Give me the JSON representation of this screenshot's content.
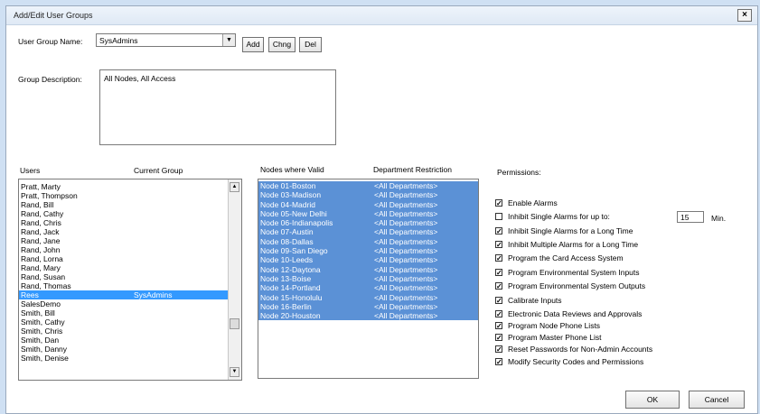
{
  "window": {
    "title": "Add/Edit User Groups",
    "close_label": "×"
  },
  "group_name": {
    "label": "User Group Name:",
    "value": "SysAdmins",
    "add_label": "Add",
    "change_label": "Chng",
    "delete_label": "Del"
  },
  "description": {
    "label": "Group Description:",
    "value": "All Nodes, All Access"
  },
  "users": {
    "col_users": "Users",
    "col_group": "Current Group",
    "rows": [
      {
        "name": "Pratt, Marty",
        "group": ""
      },
      {
        "name": "Pratt, Thompson",
        "group": ""
      },
      {
        "name": "Rand, Bill",
        "group": ""
      },
      {
        "name": "Rand, Cathy",
        "group": ""
      },
      {
        "name": "Rand, Chris",
        "group": ""
      },
      {
        "name": "Rand, Jack",
        "group": ""
      },
      {
        "name": "Rand, Jane",
        "group": ""
      },
      {
        "name": "Rand, John",
        "group": ""
      },
      {
        "name": "Rand, Lorna",
        "group": ""
      },
      {
        "name": "Rand, Mary",
        "group": ""
      },
      {
        "name": "Rand, Susan",
        "group": ""
      },
      {
        "name": "Rand, Thomas",
        "group": ""
      },
      {
        "name": "Rees",
        "group": "SysAdmins",
        "selected": true
      },
      {
        "name": "SalesDemo",
        "group": ""
      },
      {
        "name": "Smith, Bill",
        "group": ""
      },
      {
        "name": "Smith, Cathy",
        "group": ""
      },
      {
        "name": "Smith, Chris",
        "group": ""
      },
      {
        "name": "Smith, Dan",
        "group": ""
      },
      {
        "name": "Smith, Danny",
        "group": ""
      },
      {
        "name": "Smith, Denise",
        "group": ""
      }
    ]
  },
  "nodes": {
    "col_nodes": "Nodes where Valid",
    "col_dept": "Department Restriction",
    "rows": [
      {
        "node": "Node 01-Boston",
        "dept": "<All Departments>"
      },
      {
        "node": "Node 03-Madison",
        "dept": "<All Departments>"
      },
      {
        "node": "Node 04-Madrid",
        "dept": "<All Departments>"
      },
      {
        "node": "Node 05-New Delhi",
        "dept": "<All Departments>"
      },
      {
        "node": "Node 06-Indianapolis",
        "dept": "<All Departments>"
      },
      {
        "node": "Node 07-Austin",
        "dept": "<All Departments>"
      },
      {
        "node": "Node 08-Dallas",
        "dept": "<All Departments>"
      },
      {
        "node": "Node 09-San Diego",
        "dept": "<All Departments>"
      },
      {
        "node": "Node 10-Leeds",
        "dept": "<All Departments>"
      },
      {
        "node": "Node 12-Daytona",
        "dept": "<All Departments>"
      },
      {
        "node": "Node 13-Boise",
        "dept": "<All Departments>"
      },
      {
        "node": "Node 14-Portland",
        "dept": "<All Departments>"
      },
      {
        "node": "Node 15-Honolulu",
        "dept": "<All Departments>"
      },
      {
        "node": "Node 16-Berlin",
        "dept": "<All Departments>"
      },
      {
        "node": "Node 20-Houston",
        "dept": "<All Departments>"
      }
    ]
  },
  "permissions": {
    "label": "Permissions:",
    "items": [
      {
        "label": "Enable Alarms",
        "checked": true
      },
      {
        "label": "Inhibit Single Alarms for up to:",
        "checked": false
      },
      {
        "label": "Inhibit Single Alarms for a Long Time",
        "checked": true
      },
      {
        "label": "Inhibit Multiple Alarms for a Long Time",
        "checked": true
      },
      {
        "label": "Program the Card Access System",
        "checked": true
      },
      {
        "label": "Program Environmental System Inputs",
        "checked": true
      },
      {
        "label": "Program Environmental System Outputs",
        "checked": true
      },
      {
        "label": "Calibrate Inputs",
        "checked": true
      },
      {
        "label": "Electronic Data Reviews and Approvals",
        "checked": true
      },
      {
        "label": "Program Node Phone Lists",
        "checked": true
      },
      {
        "label": "Program Master Phone List",
        "checked": true
      },
      {
        "label": "Reset Passwords for Non-Admin Accounts",
        "checked": true
      },
      {
        "label": "Modify Security Codes and Permissions",
        "checked": true
      }
    ],
    "minutes_value": "15",
    "minutes_unit": "Min."
  },
  "footer": {
    "ok_label": "OK",
    "cancel_label": "Cancel"
  },
  "colors": {
    "selection": "#3399ff",
    "node_highlight": "#5b91d6",
    "background": "#cfe0f3"
  },
  "icons": {
    "close": "close-icon",
    "dropdown": "chevron-down-icon",
    "scroll_up": "scroll-up-icon",
    "scroll_down": "scroll-down-icon",
    "check": "check-icon"
  }
}
